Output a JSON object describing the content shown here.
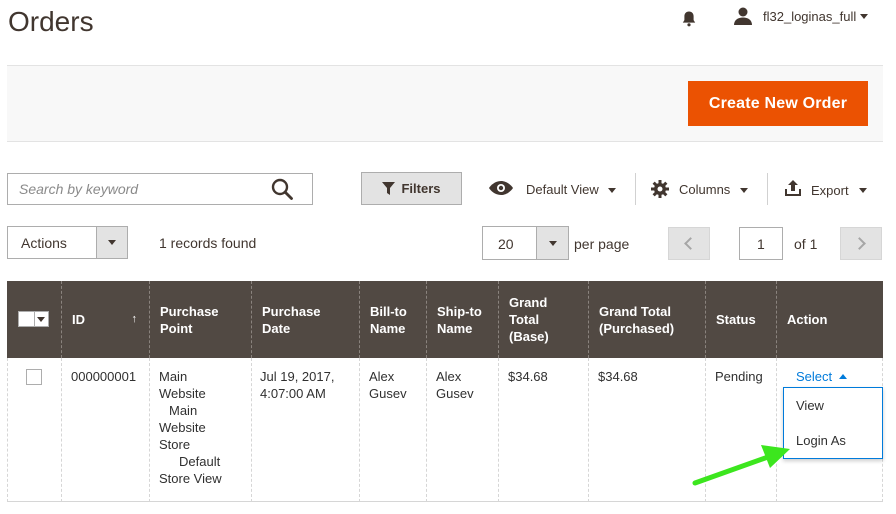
{
  "header": {
    "title": "Orders",
    "user_name": "fl32_loginas_full",
    "icons": {
      "notifications": "bell-icon",
      "user": "user-icon"
    }
  },
  "action_bar": {
    "create_button_label": "Create New Order"
  },
  "toolbar": {
    "search_placeholder": "Search by keyword",
    "filters_label": "Filters",
    "view_label": "Default View",
    "columns_label": "Columns",
    "export_label": "Export"
  },
  "grid_controls": {
    "actions_label": "Actions",
    "records_found": "1 records found",
    "per_page_value": "20",
    "per_page_label": "per page",
    "page_value": "1",
    "page_of": "of 1"
  },
  "table": {
    "headers": {
      "id": "ID",
      "sort_arrow": "↑",
      "purchase_point": "Purchase Point",
      "purchase_date": "Purchase Date",
      "bill_to": "Bill-to Name",
      "ship_to": "Ship-to Name",
      "grand_total_base": "Grand Total (Base)",
      "grand_total_purchased": "Grand Total (Purchased)",
      "status": "Status",
      "action": "Action"
    },
    "rows": [
      {
        "id": "000000001",
        "purchase_point_lines": [
          "Main",
          "Website",
          "Main",
          "Website",
          "Store",
          "Default",
          "Store View"
        ],
        "purchase_date_lines": [
          "Jul 19, 2017,",
          "4:07:00 AM"
        ],
        "bill_to_lines": [
          "Alex",
          "Gusev"
        ],
        "ship_to_lines": [
          "Alex",
          "Gusev"
        ],
        "grand_total_base": "$34.68",
        "grand_total_purchased": "$34.68",
        "status": "Pending",
        "action_label": "Select"
      }
    ],
    "action_menu": [
      "View",
      "Login As"
    ]
  },
  "colors": {
    "accent": "#eb5202",
    "header_bg": "#514943",
    "link": "#007bdb",
    "annotation_arrow": "#3ce61e"
  }
}
